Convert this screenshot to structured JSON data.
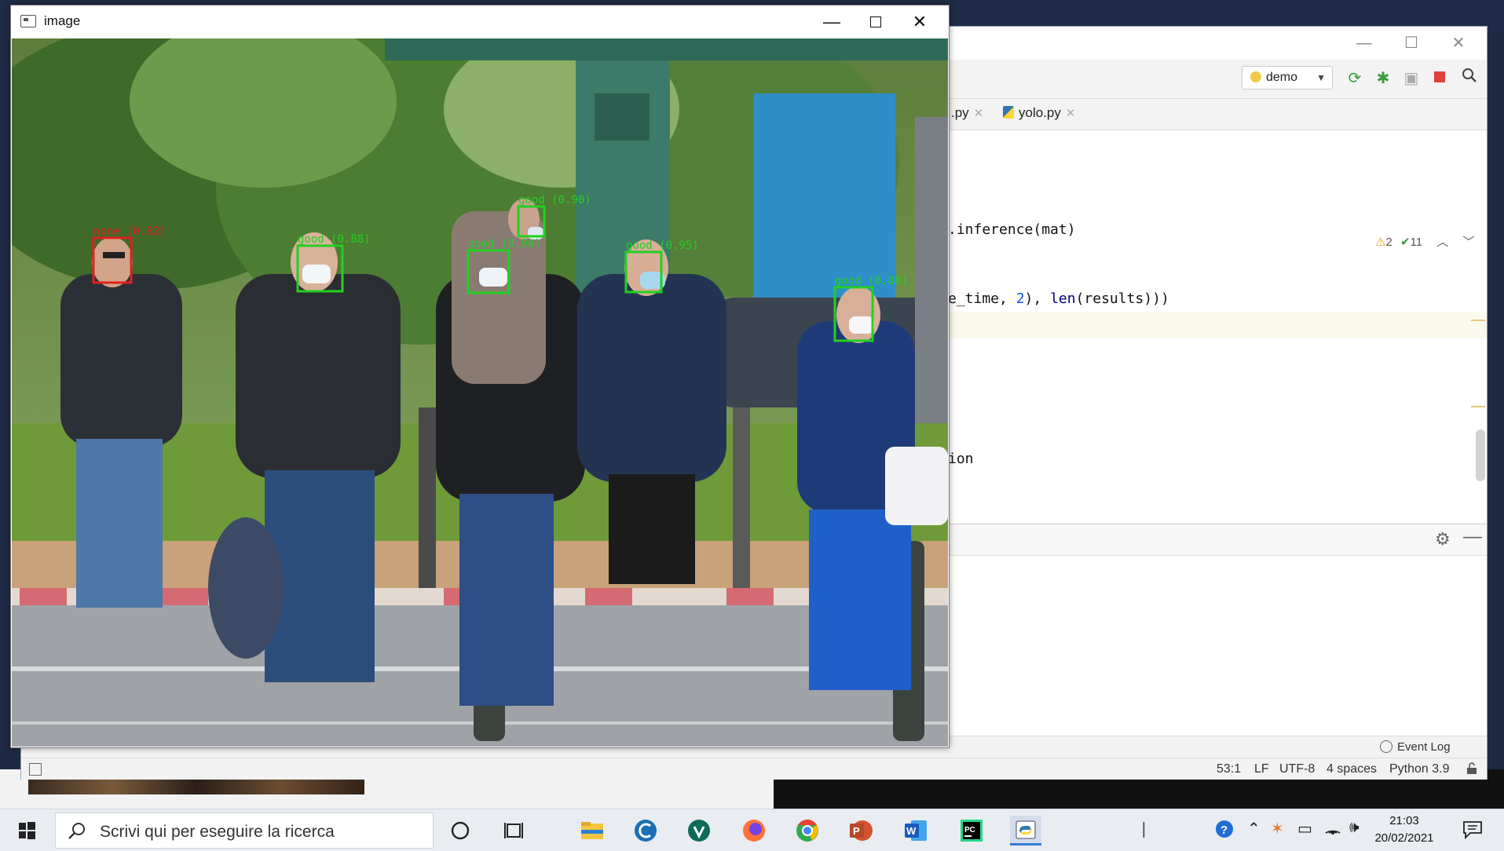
{
  "cv_window": {
    "title": "image",
    "controls": {
      "minimize": "—",
      "close": "✕"
    },
    "detections": [
      {
        "label": "none (0.82)",
        "status": "none",
        "color": "#e02020"
      },
      {
        "label": "good (0.88)",
        "status": "good",
        "color": "#22d022"
      },
      {
        "label": "good (0.90)",
        "status": "good",
        "color": "#22d022"
      },
      {
        "label": "good (0.90)",
        "status": "good",
        "color": "#22d022"
      },
      {
        "label": "good (0.95)",
        "status": "good",
        "color": "#22d022"
      },
      {
        "label": "good (0.88)",
        "status": "good",
        "color": "#22d022"
      }
    ]
  },
  "ide": {
    "run_config": "demo",
    "tabs": [
      {
        "name": ".py"
      },
      {
        "name": "yolo.py"
      }
    ],
    "inspections": {
      "warnings": "2",
      "ok": "11"
    },
    "code": {
      "line1": ".inference(mat)",
      "line2_a": "e_time, ",
      "line2_num": "2",
      "line2_b": "), ",
      "line2_len": "len",
      "line2_c": "(results)))",
      "line3": "ion"
    },
    "tool_window": {
      "event_log": "Event Log"
    },
    "status": {
      "position": "53:1",
      "line_sep": "LF",
      "encoding": "UTF-8",
      "indent": "4 spaces",
      "interpreter": "Python 3.9"
    }
  },
  "taskbar": {
    "search_placeholder": "Scrivi qui per eseguire la ricerca",
    "time": "21:03",
    "date": "20/02/2021",
    "apps": [
      "cortana",
      "task-view",
      "file-explorer",
      "ccleaner",
      "vpn",
      "firefox",
      "chrome",
      "powerpoint",
      "word",
      "pycharm",
      "python"
    ]
  }
}
